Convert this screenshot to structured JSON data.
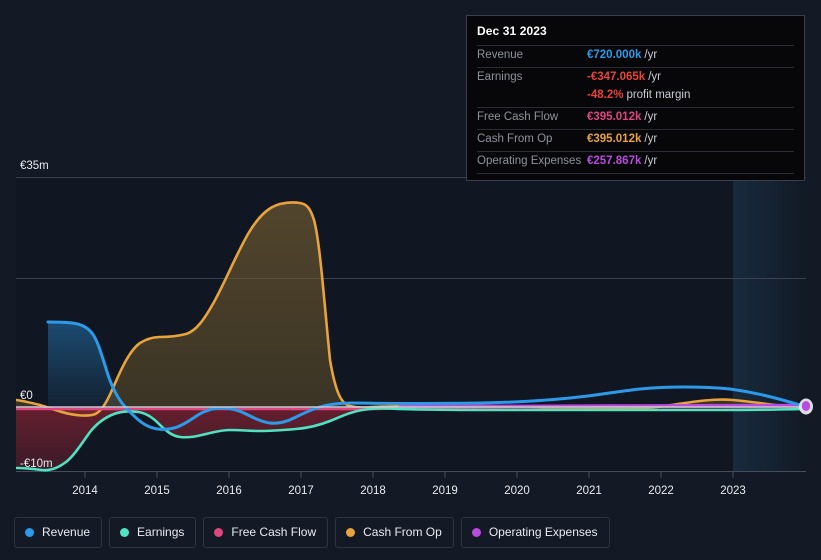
{
  "tooltip": {
    "title": "Dec 31 2023",
    "rows": [
      {
        "label": "Revenue",
        "value": "€720.000k",
        "unit": "/yr",
        "color": "#2c9ae8"
      },
      {
        "label": "Earnings",
        "value": "-€347.065k",
        "unit": "/yr",
        "color": "#e8443a"
      },
      {
        "label": "",
        "value": "-48.2%",
        "unit": "profit margin",
        "color": "#e8443a"
      },
      {
        "label": "Free Cash Flow",
        "value": "€395.012k",
        "unit": "/yr",
        "color": "#e0457f"
      },
      {
        "label": "Cash From Op",
        "value": "€395.012k",
        "unit": "/yr",
        "color": "#e8a33d"
      },
      {
        "label": "Operating Expenses",
        "value": "€257.867k",
        "unit": "/yr",
        "color": "#b94ae0"
      }
    ]
  },
  "axis": {
    "y_top": "€35m",
    "y_zero": "€0",
    "y_bottom": "-€10m",
    "x_ticks": [
      "2014",
      "2015",
      "2016",
      "2017",
      "2018",
      "2019",
      "2020",
      "2021",
      "2022",
      "2023"
    ]
  },
  "legend": [
    {
      "label": "Revenue",
      "color": "#2c9ae8"
    },
    {
      "label": "Earnings",
      "color": "#4fe3c1"
    },
    {
      "label": "Free Cash Flow",
      "color": "#e0457f"
    },
    {
      "label": "Cash From Op",
      "color": "#e8a33d"
    },
    {
      "label": "Operating Expenses",
      "color": "#b94ae0"
    }
  ],
  "chart_data": {
    "type": "line",
    "title": "",
    "xlabel": "",
    "ylabel": "",
    "currency": "EUR",
    "ylim": [
      -10000000,
      35000000
    ],
    "y_ticks": [
      35000000,
      17500000,
      0,
      -10000000
    ],
    "y_tick_labels": [
      "€35m",
      "",
      "€0",
      "-€10m"
    ],
    "grid": true,
    "legend_position": "bottom",
    "x_range": [
      "2013-07-01",
      "2024-01-01"
    ],
    "x_tick_labels": [
      "2014",
      "2015",
      "2016",
      "2017",
      "2018",
      "2019",
      "2020",
      "2021",
      "2022",
      "2023"
    ],
    "forecast_shading_starts": "2023-01-01",
    "x": [
      "2013-07",
      "2013-10",
      "2014-01",
      "2014-04",
      "2014-07",
      "2014-10",
      "2015-01",
      "2015-04",
      "2015-07",
      "2015-10",
      "2016-01",
      "2016-04",
      "2016-07",
      "2016-10",
      "2017-01",
      "2017-04",
      "2017-07",
      "2017-10",
      "2018-01",
      "2018-04",
      "2018-07",
      "2018-10",
      "2019-01",
      "2019-07",
      "2020-01",
      "2020-07",
      "2021-01",
      "2021-07",
      "2022-01",
      "2022-07",
      "2023-01",
      "2023-07",
      "2023-12"
    ],
    "series": [
      {
        "name": "Revenue",
        "color": "#2c9ae8",
        "units": "EUR",
        "values": [
          13000000,
          12900000,
          12700000,
          9500000,
          3200000,
          -600000,
          -1900000,
          -2600000,
          -2000000,
          -700000,
          -300000,
          -200000,
          -400000,
          -1000000,
          -1500000,
          -900000,
          -300000,
          100000,
          300000,
          350000,
          380000,
          400000,
          420000,
          450000,
          520000,
          600000,
          900000,
          1500000,
          1700000,
          1650000,
          1400000,
          950000,
          720000
        ]
      },
      {
        "name": "Earnings",
        "color": "#4fe3c1",
        "units": "EUR",
        "values": [
          -9300000,
          -9400000,
          -9600000,
          -9800000,
          -7000000,
          -4300000,
          -2700000,
          -1700000,
          -1300000,
          -1100000,
          -1400000,
          -2500000,
          -3600000,
          -3800000,
          -3700000,
          -3600000,
          -3500000,
          -3400000,
          -2300000,
          -1100000,
          -550000,
          -420000,
          -380000,
          -350000,
          -320000,
          -300000,
          -330000,
          -360000,
          -400000,
          -420000,
          -380000,
          -360000,
          -347065
        ]
      },
      {
        "name": "Free Cash Flow",
        "color": "#e0457f",
        "units": "EUR",
        "values": [
          -300000,
          -300000,
          -300000,
          -300000,
          -300000,
          -300000,
          -300000,
          -300000,
          -300000,
          -300000,
          -300000,
          -300000,
          -300000,
          -300000,
          -300000,
          -300000,
          -300000,
          -300000,
          -250000,
          -150000,
          -50000,
          50000,
          120000,
          180000,
          230000,
          270000,
          300000,
          330000,
          350000,
          370000,
          380000,
          390000,
          395012
        ]
      },
      {
        "name": "Cash From Op",
        "color": "#e8a33d",
        "units": "EUR",
        "values": [
          1100000,
          1050000,
          900000,
          600000,
          300000,
          200000,
          250000,
          2500000,
          8500000,
          11600000,
          11700000,
          11900000,
          12000000,
          15500000,
          22000000,
          28000000,
          30800000,
          31000000,
          14000000,
          1200000,
          300000,
          200000,
          180000,
          170000,
          200000,
          150000,
          -120000,
          -250000,
          -80000,
          350000,
          900000,
          600000,
          395012
        ]
      },
      {
        "name": "Operating Expenses",
        "color": "#b94ae0",
        "units": "EUR",
        "values": [
          null,
          null,
          null,
          null,
          null,
          null,
          null,
          null,
          null,
          null,
          null,
          null,
          null,
          null,
          null,
          null,
          null,
          null,
          null,
          null,
          null,
          null,
          180000,
          200000,
          220000,
          230000,
          240000,
          245000,
          250000,
          252000,
          255000,
          256000,
          257867
        ]
      }
    ]
  }
}
